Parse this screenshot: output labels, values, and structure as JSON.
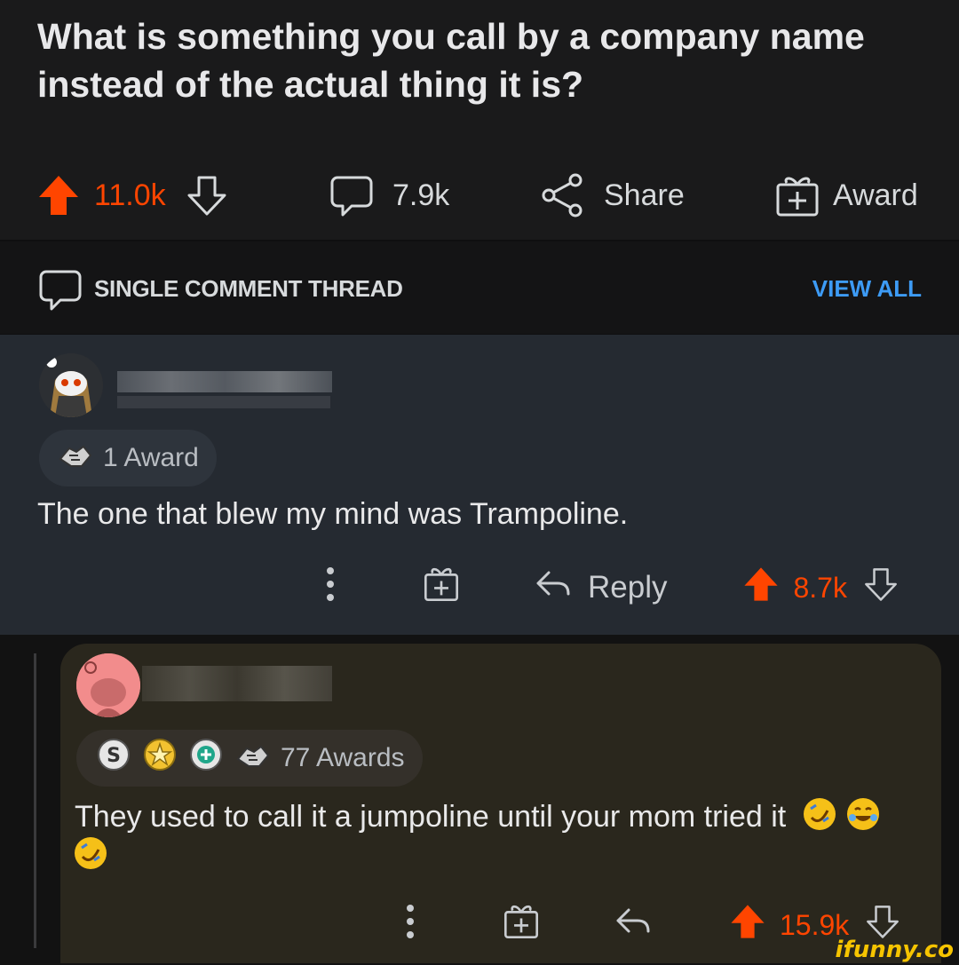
{
  "post": {
    "title": "What is something you call by a company name instead of the actual thing it is?",
    "votes": "11.0k",
    "comments": "7.9k",
    "share_label": "Share",
    "award_label": "Award"
  },
  "thread": {
    "label": "SINGLE COMMENT THREAD",
    "view_all": "VIEW ALL"
  },
  "comment1": {
    "awards": "1 Award",
    "body": "The one that blew my mind was Trampoline.",
    "reply_label": "Reply",
    "votes": "8.7k"
  },
  "comment2": {
    "awards": "77 Awards",
    "body": "They used to call it a jumpoline until your mom tried it",
    "votes": "15.9k"
  },
  "watermark": "ifunny.co",
  "colors": {
    "upvote": "#ff4500",
    "link": "#3d9bf5",
    "comment1_bg": "#252a31",
    "comment2_bg": "#2a271d"
  }
}
